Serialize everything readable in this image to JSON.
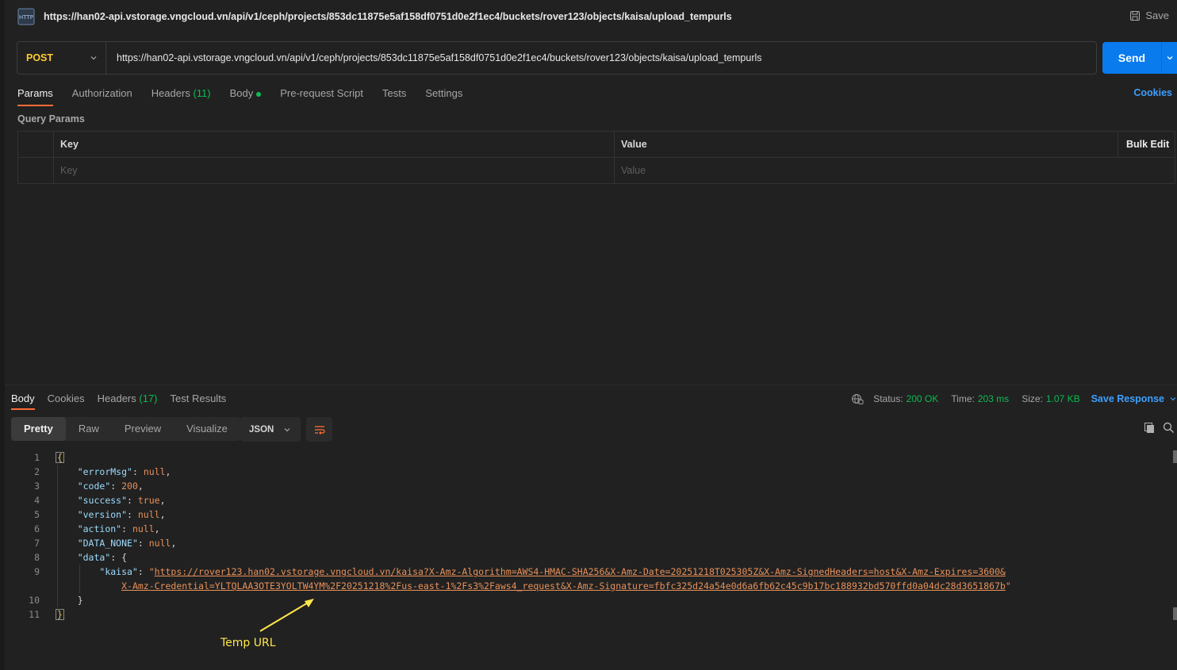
{
  "header": {
    "title": "https://han02-api.vstorage.vngcloud.vn/api/v1/ceph/projects/853dc11875e5af158df0751d0e2f1ec4/buckets/rover123/objects/kaisa/upload_tempurls",
    "save_label": "Save",
    "icon": "http-request-icon",
    "icon_text": "HTTP"
  },
  "request": {
    "method": "POST",
    "url": "https://han02-api.vstorage.vngcloud.vn/api/v1/ceph/projects/853dc11875e5af158df0751d0e2f1ec4/buckets/rover123/objects/kaisa/upload_tempurls",
    "send_label": "Send"
  },
  "request_tabs": {
    "params": "Params",
    "authorization": "Authorization",
    "headers": "Headers",
    "headers_count": "(11)",
    "body": "Body",
    "prerequest": "Pre-request Script",
    "tests": "Tests",
    "settings": "Settings",
    "cookies": "Cookies"
  },
  "query_params": {
    "title": "Query Params",
    "key_header": "Key",
    "value_header": "Value",
    "bulk_edit": "Bulk Edit",
    "key_placeholder": "Key",
    "value_placeholder": "Value"
  },
  "response_tabs": {
    "body": "Body",
    "cookies": "Cookies",
    "headers": "Headers",
    "headers_count": "(17)",
    "test_results": "Test Results"
  },
  "status": {
    "status_label": "Status:",
    "status_value": "200 OK",
    "time_label": "Time:",
    "time_value": "203 ms",
    "size_label": "Size:",
    "size_value": "1.07 KB",
    "save_response": "Save Response"
  },
  "format": {
    "pretty": "Pretty",
    "raw": "Raw",
    "preview": "Preview",
    "visualize": "Visualize",
    "type": "JSON"
  },
  "code": {
    "line_numbers": [
      "1",
      "2",
      "3",
      "4",
      "5",
      "6",
      "7",
      "8",
      "9",
      "",
      "10",
      "11"
    ],
    "open_brace": "{",
    "close_brace": "}",
    "k_errorMsg": "\"errorMsg\"",
    "k_code": "\"code\"",
    "k_success": "\"success\"",
    "k_version": "\"version\"",
    "k_action": "\"action\"",
    "k_data_none": "\"DATA_NONE\"",
    "k_data": "\"data\"",
    "k_kaisa": "\"kaisa\"",
    "v_null": "null",
    "v_code": "200",
    "v_true": "true",
    "url_part1": "https://rover123.han02.vstorage.vngcloud.vn/kaisa?X-Amz-Algorithm=AWS4-HMAC-SHA256&X-Amz-Date=20251218T025305Z&X-Amz-SignedHeaders=host&X-Amz-Expires=3600&",
    "url_part2": "X-Amz-Credential=YLTQLAA3OTE3YOLTW4YM%2F20251218%2Fus-east-1%2Fs3%2Faws4_request&X-Amz-Signature=fbfc325d24a54e0d6a6fb62c45c9b17bc188932bd570ffd0a04dc28d3651867b"
  },
  "annotation": {
    "label": "Temp URL",
    "color": "#ffe84a"
  }
}
